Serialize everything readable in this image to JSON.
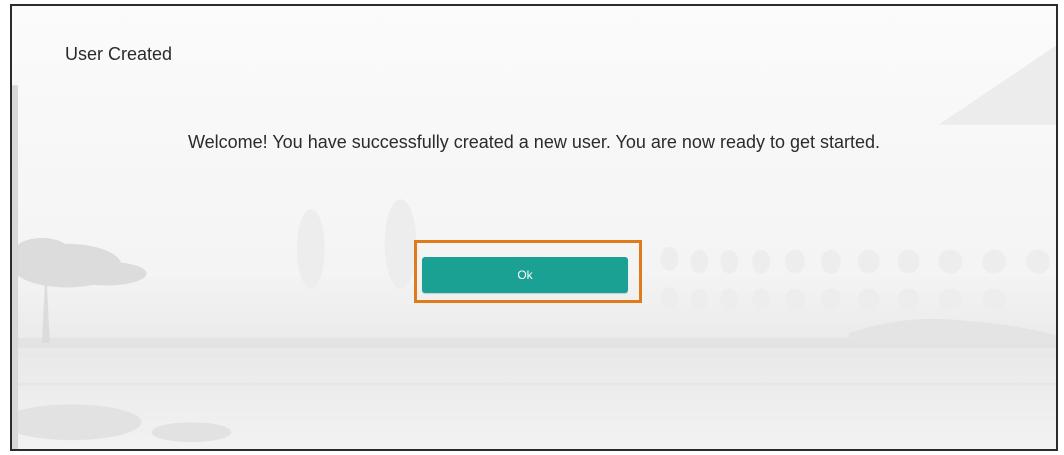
{
  "dialog": {
    "title": "User Created",
    "message": "Welcome! You have successfully created a new user. You are now ready to get started.",
    "ok_label": "Ok"
  },
  "colors": {
    "button": "#1ba193",
    "highlight": "#e07b1b",
    "border": "#2b2b2b"
  }
}
